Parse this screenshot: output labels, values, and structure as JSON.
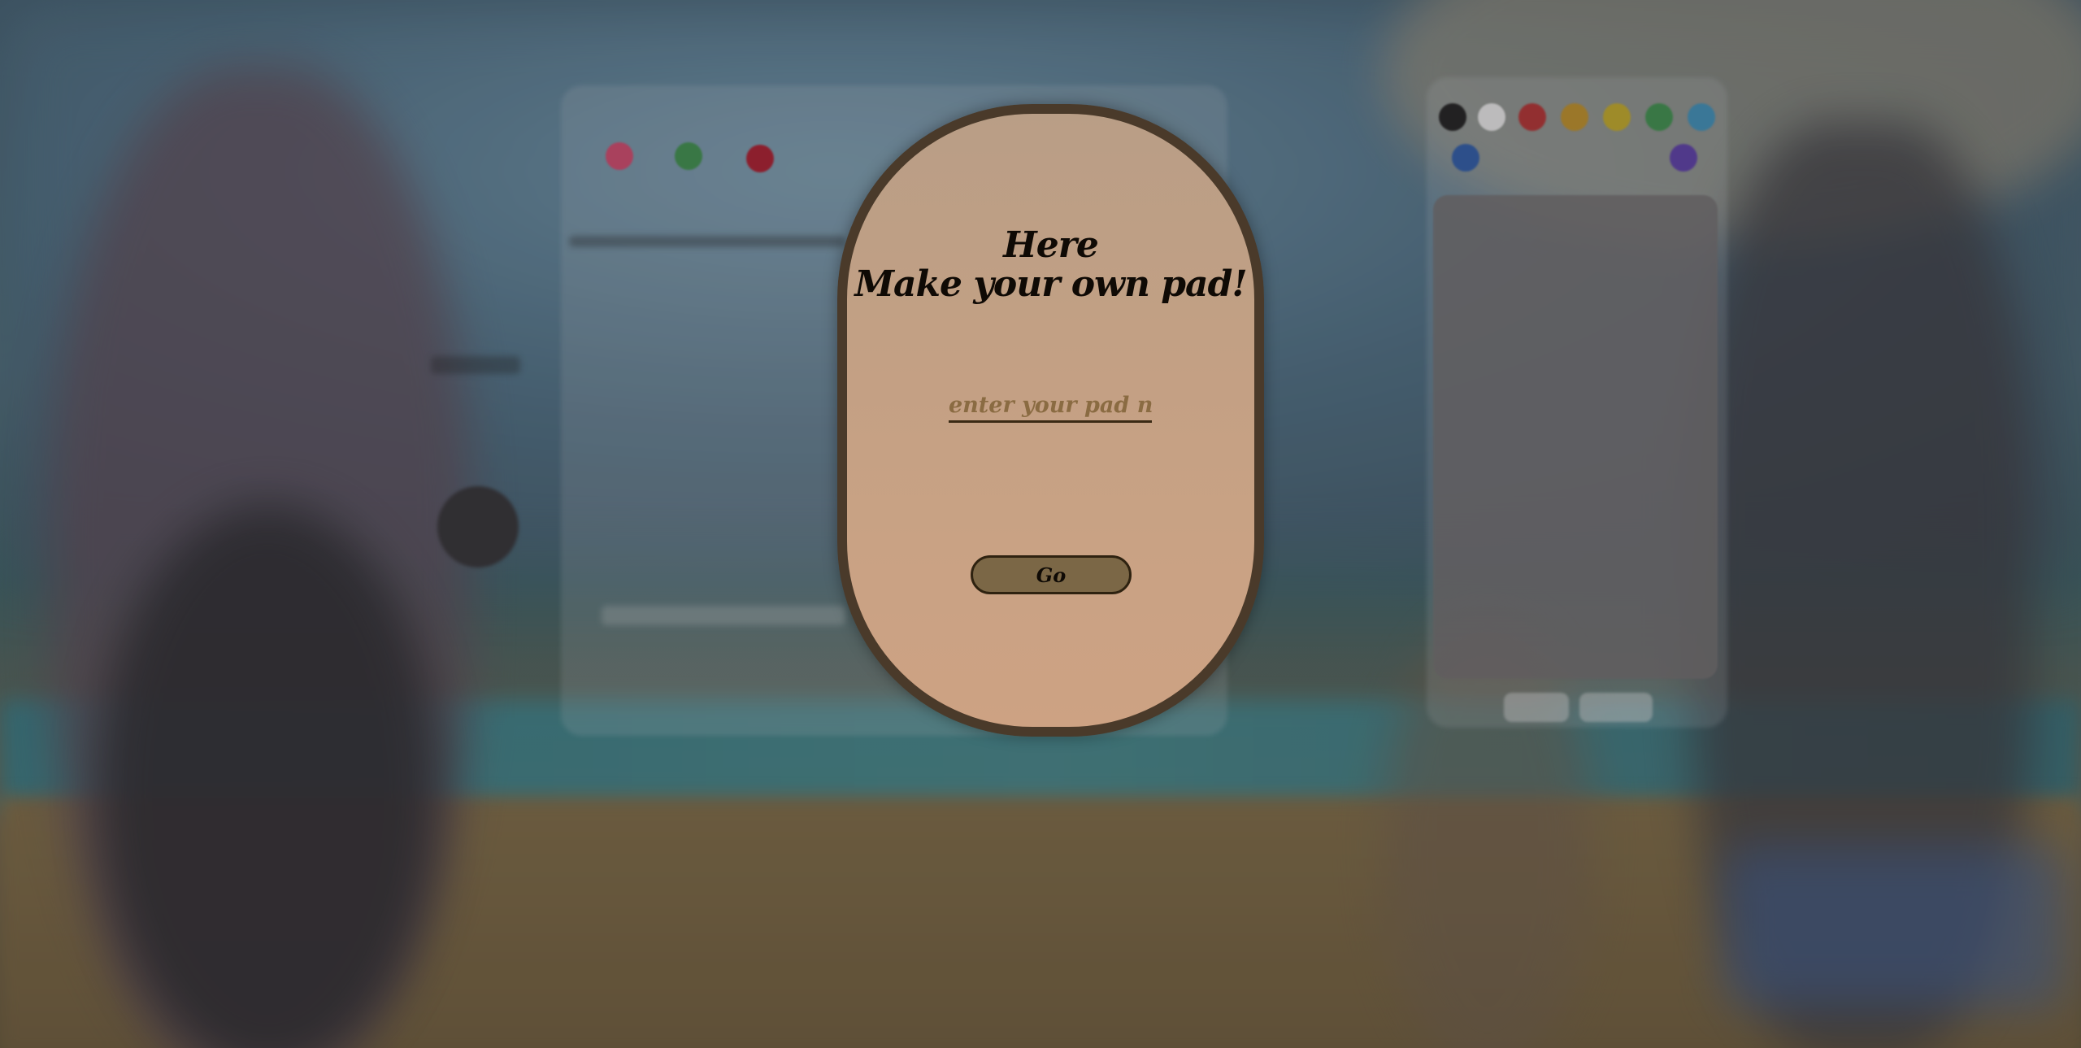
{
  "modal": {
    "title_line1": "Here",
    "title_line2": "Make your own pad!",
    "input_placeholder": "enter your pad name",
    "input_value": "",
    "go_label": "Go"
  },
  "colors": {
    "modal_background": "#c3a084",
    "modal_border": "#4a3a2a",
    "go_button_fill": "#7b6746",
    "input_underline": "#3a2a14",
    "placeholder_color": "#8a6b42"
  }
}
